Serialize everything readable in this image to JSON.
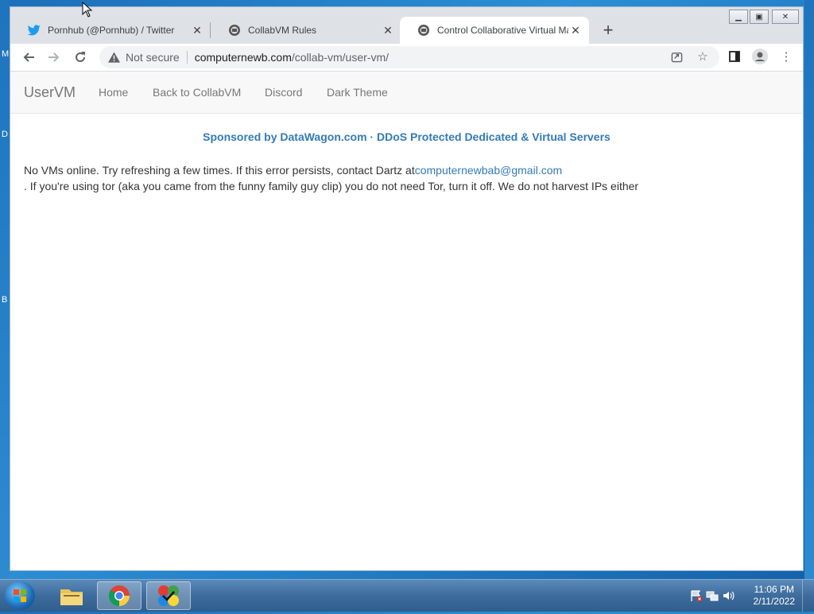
{
  "desktop": {
    "left_letters": [
      "M",
      "D",
      "B"
    ]
  },
  "browser": {
    "tabs": [
      {
        "title": "Pornhub (@Pornhub) / Twitter",
        "icon": "twitter-icon",
        "active": false
      },
      {
        "title": "CollabVM Rules",
        "icon": "collabvm-icon",
        "active": false
      },
      {
        "title": "Control Collaborative Virtual Machines",
        "icon": "collabvm-icon",
        "active": true
      }
    ],
    "address": {
      "security_label": "Not secure",
      "host": "computernewb.com",
      "path": "/collab-vm/user-vm/"
    }
  },
  "site": {
    "brand": "UserVM",
    "nav": [
      "Home",
      "Back to CollabVM",
      "Discord",
      "Dark Theme"
    ],
    "sponsor": "Sponsored by DataWagon.com · DDoS Protected Dedicated & Virtual Servers",
    "message_part1": "No VMs online. Try refreshing a few times. If this error persists, contact Dartz at",
    "message_email": "computernewbab@gmail.com",
    "message_part2": ". If you're using tor (aka you came from the funny family guy clip) you do not need Tor, turn it off. We do not harvest IPs either"
  },
  "taskbar": {
    "time": "11:06 PM",
    "date": "2/11/2022"
  },
  "colors": {
    "link": "#337ab7",
    "twitter": "#1d9bf0"
  }
}
